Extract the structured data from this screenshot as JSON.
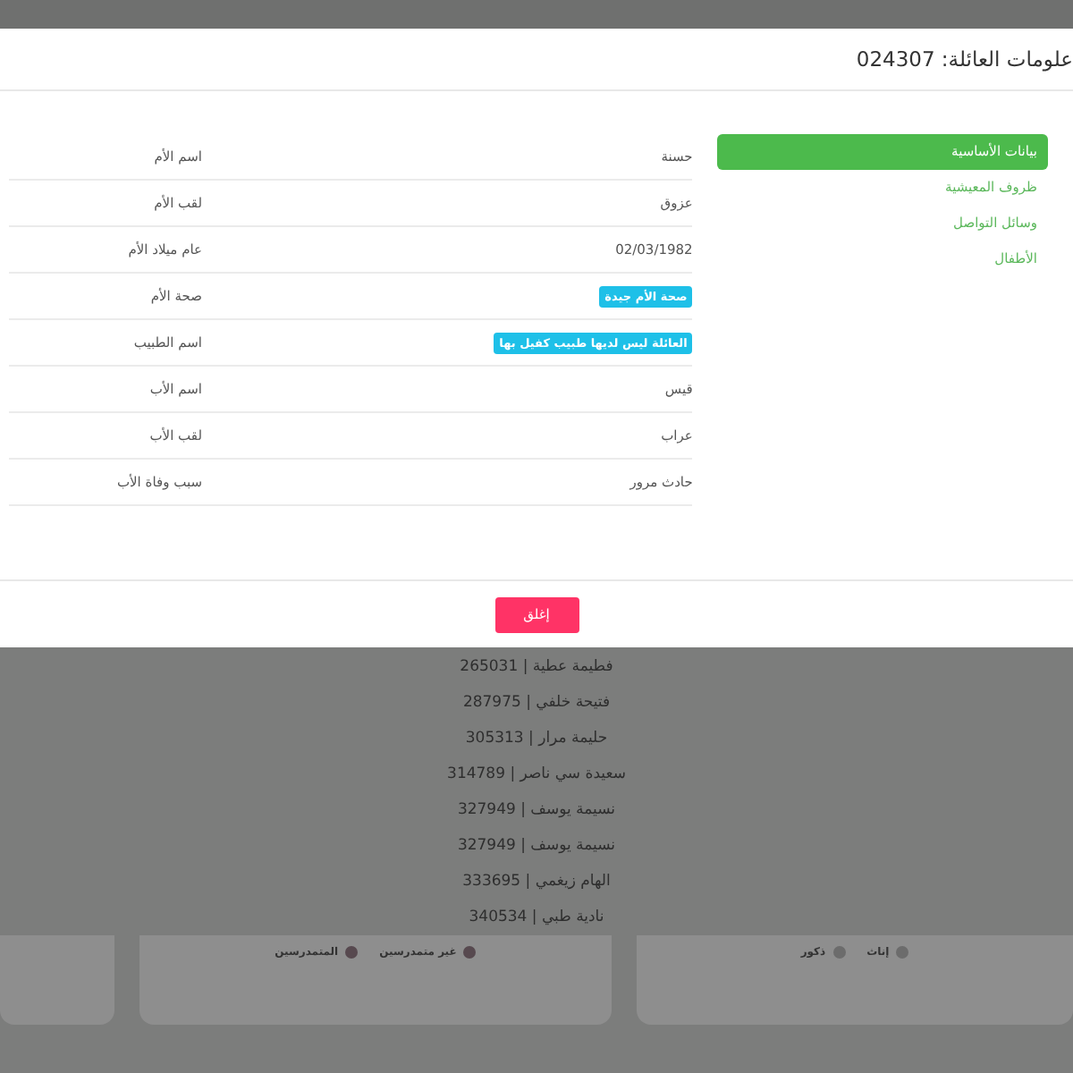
{
  "modal": {
    "title": "علومات العائلة: 024307",
    "nav": [
      {
        "label": "بيانات الأساسية",
        "selected": true
      },
      {
        "label": "ظروف المعيشية",
        "selected": false
      },
      {
        "label": "وسائل التواصل",
        "selected": false
      },
      {
        "label": "الأطفال",
        "selected": false
      }
    ],
    "fields": [
      {
        "label": "اسم الأم",
        "value": "حسنة",
        "kind": "text"
      },
      {
        "label": "لقب الأم",
        "value": "عزوق",
        "kind": "text"
      },
      {
        "label": "عام ميلاد الأم",
        "value": "02/03/1982",
        "kind": "text"
      },
      {
        "label": "صحة الأم",
        "value": "صحة الأم جيدة",
        "kind": "badge"
      },
      {
        "label": "اسم الطبيب",
        "value": "العائلة ليس لديها طبيب كفيل بها",
        "kind": "badge"
      },
      {
        "label": "اسم الأب",
        "value": "قيس",
        "kind": "text"
      },
      {
        "label": "لقب الأب",
        "value": "عراب",
        "kind": "text"
      },
      {
        "label": "سبب وفاة الأب",
        "value": "حادث مرور",
        "kind": "text"
      }
    ],
    "close_button": "إغلق"
  },
  "background": {
    "list": [
      "فطيمة عطية | 265031",
      "فتيحة خلفي | 287975",
      "حليمة مرار | 305313",
      "سعيدة سي ناصر | 314789",
      "نسيمة يوسف | 327949",
      "نسيمة يوسف | 327949",
      "الهام زيغمي | 333695",
      "نادية طبي | 340534"
    ],
    "cards": [
      {
        "legend": [
          {
            "label": "إناث",
            "color": "#6c6c6c"
          },
          {
            "label": "ذكور",
            "color": "#6c6c6c"
          }
        ]
      },
      {
        "legend": [
          {
            "label": "غير متمدرسين",
            "color": "#57494f"
          },
          {
            "label": "المتمدرسين",
            "color": "#57494f"
          }
        ]
      }
    ]
  }
}
